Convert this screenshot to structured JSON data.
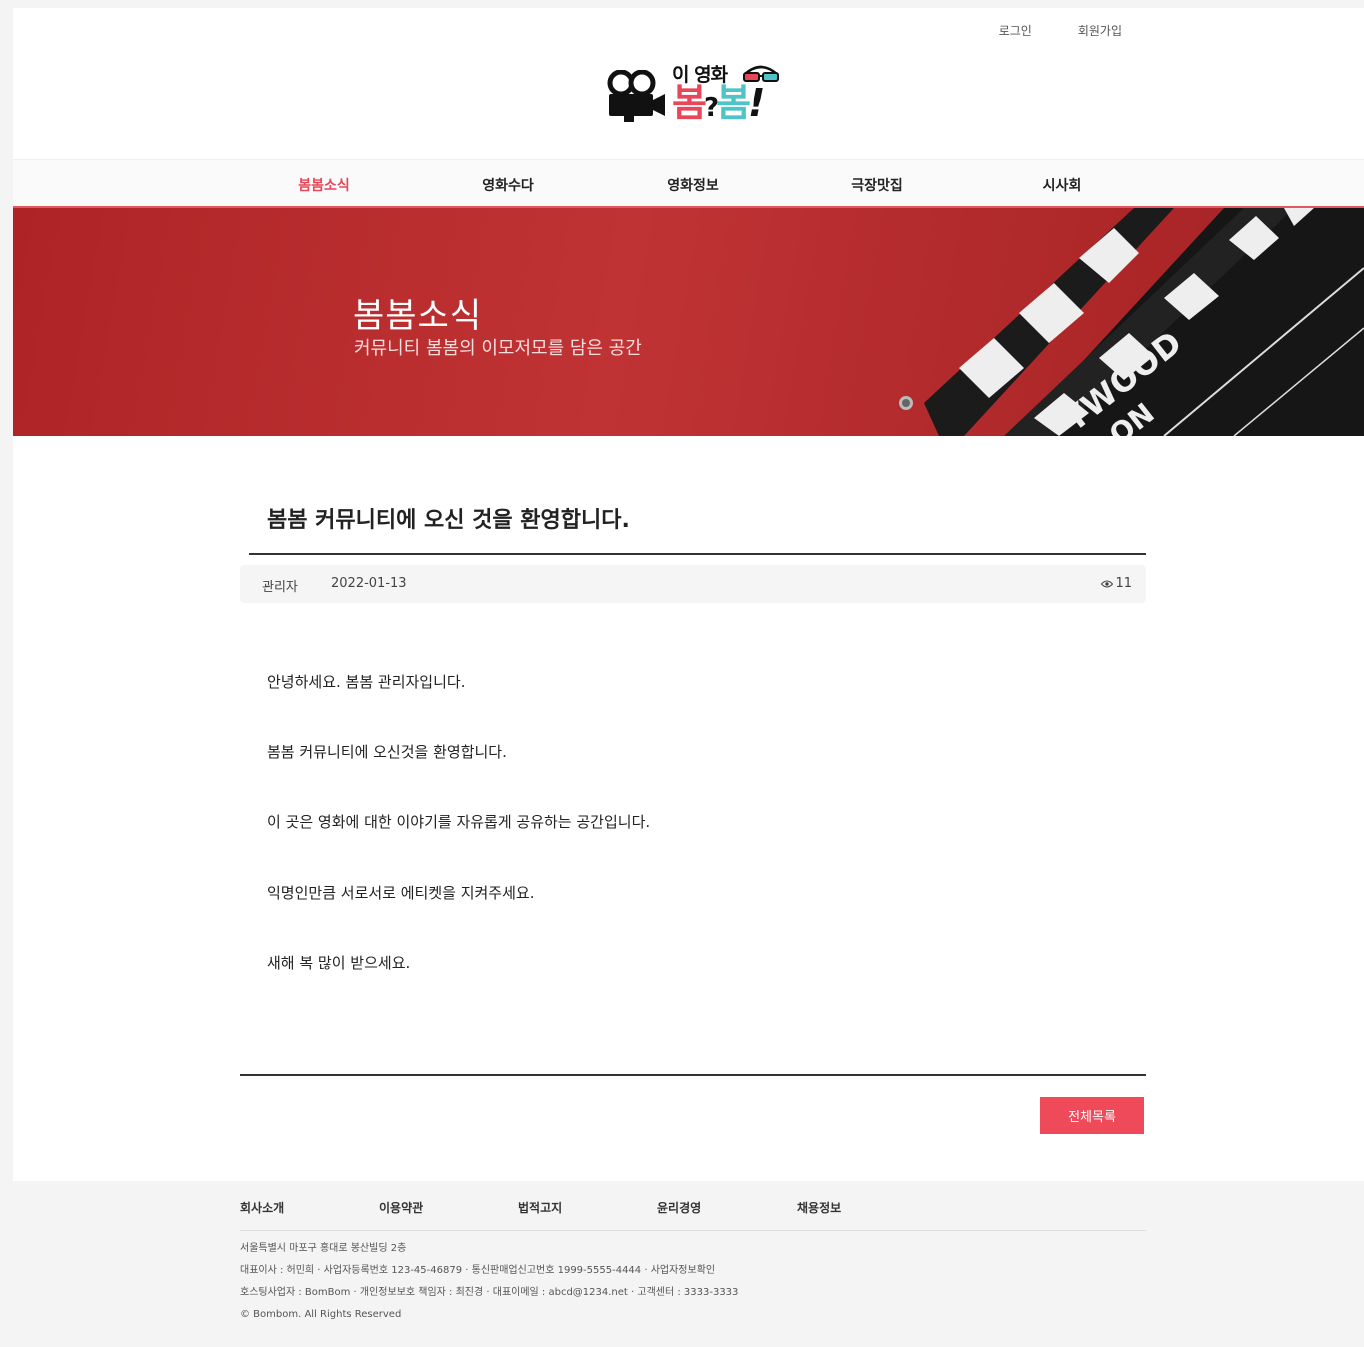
{
  "header": {
    "login": "로그인",
    "signup": "회원가입",
    "logo": {
      "small": "이 영화",
      "big_left": "봄",
      "big_q": "?",
      "big_right": "봄",
      "big_excl": "!"
    }
  },
  "nav": {
    "items": [
      "봄봄소식",
      "영화수다",
      "영화정보",
      "극장맛집",
      "시사회"
    ],
    "active": "봄봄소식"
  },
  "hero": {
    "title": "봄봄소식",
    "subtitle": "커뮤니티 봄봄의 이모저모를 담은 공간",
    "clapper_text_1": "YWOOD",
    "clapper_text_2": "ON"
  },
  "post": {
    "title": "봄봄 커뮤니티에 오신 것을 환영합니다.",
    "author": "관리자",
    "date": "2022-01-13",
    "views": "11",
    "paragraphs": [
      "안녕하세요. 봄봄 관리자입니다.",
      "봄봄 커뮤니티에 오신것을 환영합니다.",
      "이 곳은 영화에 대한 이야기를 자유롭게 공유하는 공간입니다.",
      "익명인만큼 서로서로 에티켓을 지켜주세요.",
      "새해 복 많이 받으세요."
    ],
    "list_button": "전체목록"
  },
  "footer": {
    "links": [
      "회사소개",
      "이용약관",
      "법적고지",
      "윤리경영",
      "채용정보"
    ],
    "address": "서울특별시 마포구 홍대로 봉산빌딩 2층",
    "line2": "대표이사 : 허민희 · 사업자등록번호 123-45-46879 · 통신판매업신고번호 1999-5555-4444 · 사업자정보확인",
    "line3": "호스팅사업자 : BomBom · 개인정보보호 책임자 : 최진경 · 대표이메일 : abcd@1234.net · 고객센터 : 3333-3333",
    "copyright": "© Bombom. All Rights Reserved"
  },
  "colors": {
    "accent": "#e8475a",
    "button": "#ee4a5a",
    "hero_red": "#b52a2c",
    "logo_cyan": "#4ec3c8"
  }
}
